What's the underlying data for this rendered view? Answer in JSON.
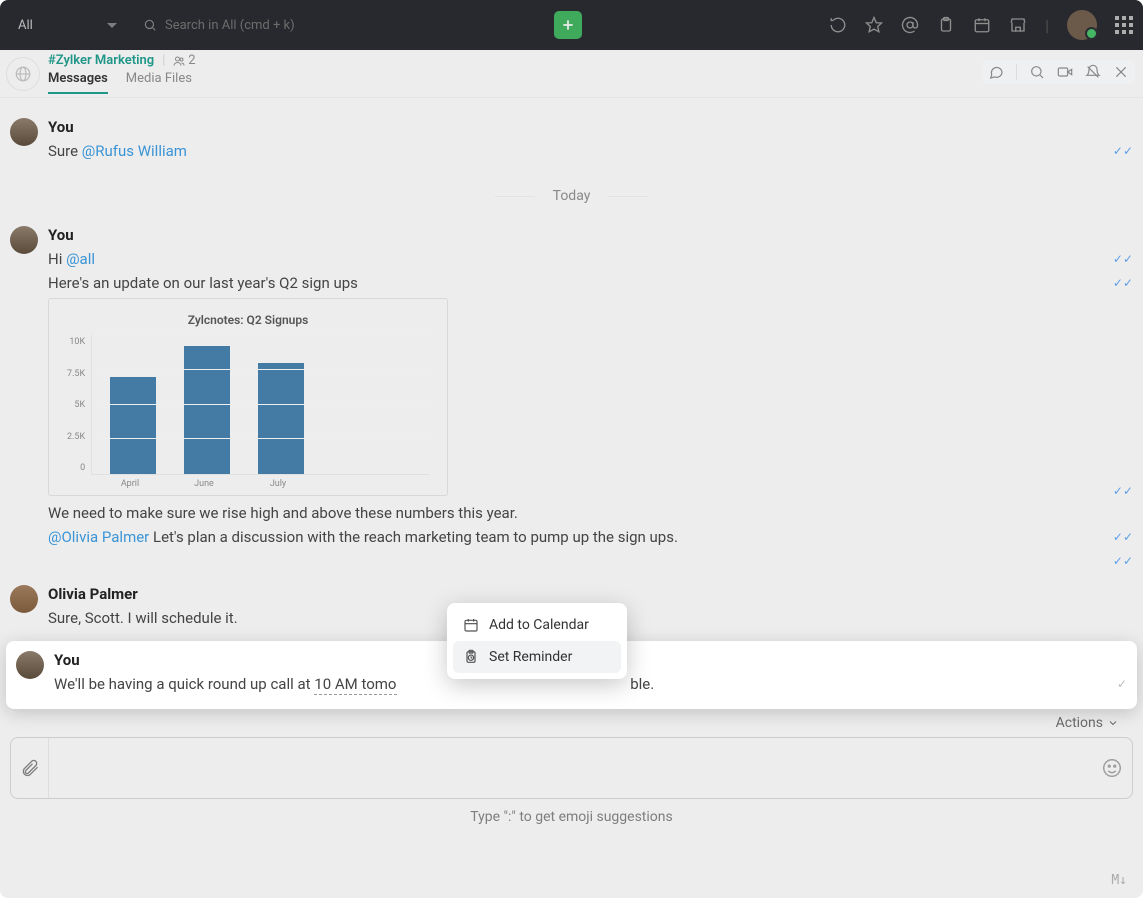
{
  "topbar": {
    "filter_label": "All",
    "search_placeholder": "Search in All (cmd + k)"
  },
  "channel": {
    "name": "#Zylker Marketing",
    "member_count": "2",
    "tabs": {
      "messages": "Messages",
      "media": "Media Files"
    }
  },
  "date_separator": "Today",
  "messages": {
    "m0": {
      "author": "You",
      "text_prefix": "Sure ",
      "mention": "@Rufus William"
    },
    "m1": {
      "author": "You",
      "line1_prefix": "Hi ",
      "line1_mention": "@all",
      "line2": "Here's an update on our last year's Q2 sign ups",
      "line3": "We need to make sure we rise high and above these numbers this year.",
      "line4_mention": "@Olivia Palmer",
      "line4_rest": " Let's plan a discussion with the reach marketing team to pump up the sign ups."
    },
    "m2": {
      "author": "Olivia Palmer",
      "text": "Sure, Scott. I will schedule it."
    },
    "m3": {
      "author": "You",
      "text_before": "We'll be having a quick round up call at ",
      "time_text": "10 AM tomo",
      "text_after_trunc": "ble."
    }
  },
  "popover": {
    "add_calendar": "Add to Calendar",
    "set_reminder": "Set Reminder"
  },
  "actions_label": "Actions",
  "footer_hint": "Type \":\" to get emoji suggestions",
  "md_label": "M↓",
  "chart_data": {
    "type": "bar",
    "title": "Zylcnotes: Q2 Signups",
    "categories": [
      "April",
      "June",
      "July"
    ],
    "values": [
      7000,
      9200,
      8000
    ],
    "yticks": [
      "10K",
      "7.5K",
      "5K",
      "2.5K",
      "0"
    ],
    "ylim": [
      0,
      10000
    ]
  }
}
